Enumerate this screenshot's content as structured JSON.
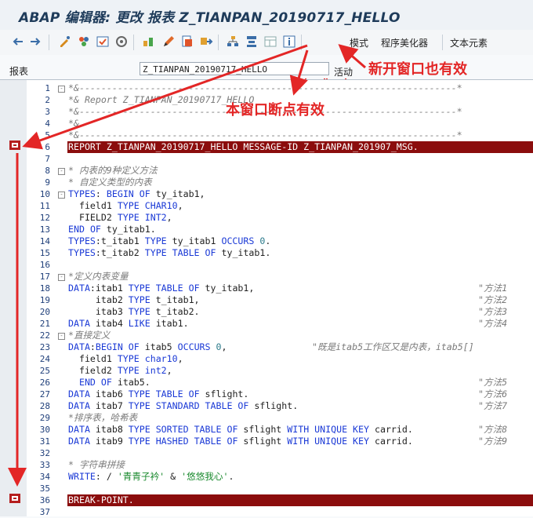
{
  "window": {
    "title": "ABAP 编辑器: 更改 报表 Z_TIANPAN_20190717_HELLO"
  },
  "toolbar": {
    "mode_label": "模式",
    "pretty_printer_label": "程序美化器",
    "text_elements_label": "文本元素"
  },
  "fields": {
    "report_label": "报表",
    "report_value": "Z_TIANPAN_20190717_HELLO",
    "status": "活动"
  },
  "annotations": {
    "new_window": "新开窗口也有效",
    "this_window": "本窗口断点有效"
  },
  "lines": [
    {
      "n": "1",
      "t": "*&---------------------------------------------------------------------*"
    },
    {
      "n": "2",
      "t": "*& Report Z_TIANPAN_20190717_HELLO"
    },
    {
      "n": "3",
      "t": "*&---------------------------------------------------------------------*"
    },
    {
      "n": "4",
      "t": "*&"
    },
    {
      "n": "5",
      "t": "*&---------------------------------------------------------------------*"
    },
    {
      "n": "6",
      "t": "REPORT Z_TIANPAN_20190717_HELLO MESSAGE-ID Z_TIANPAN_201907_MSG."
    },
    {
      "n": "7",
      "t": ""
    },
    {
      "n": "8",
      "t": "* 内表的9种定义方法"
    },
    {
      "n": "9",
      "t": "* 自定义类型的内表"
    },
    {
      "n": "10",
      "t": "TYPES: BEGIN OF ty_itab1,"
    },
    {
      "n": "11",
      "t": "  field1 TYPE CHAR10,"
    },
    {
      "n": "12",
      "t": "  FIELD2 TYPE INT2,"
    },
    {
      "n": "13",
      "t": "END OF ty_itab1."
    },
    {
      "n": "14",
      "t": "TYPES:t_itab1 TYPE ty_itab1 OCCURS 0."
    },
    {
      "n": "15",
      "t": "TYPES:t_itab2 TYPE TABLE OF ty_itab1."
    },
    {
      "n": "16",
      "t": ""
    },
    {
      "n": "17",
      "t": "*定义内表变量"
    },
    {
      "n": "18",
      "t": "DATA:itab1 TYPE TABLE OF ty_itab1,"
    },
    {
      "n": "19",
      "t": "     itab2 TYPE t_itab1,"
    },
    {
      "n": "20",
      "t": "     itab3 TYPE t_itab2."
    },
    {
      "n": "21",
      "t": "DATA itab4 LIKE itab1."
    },
    {
      "n": "22",
      "t": "*直接定义"
    },
    {
      "n": "23",
      "t": "DATA:BEGIN OF itab5 OCCURS 0,"
    },
    {
      "n": "24",
      "t": "  field1 TYPE char10,"
    },
    {
      "n": "25",
      "t": "  field2 TYPE int2,"
    },
    {
      "n": "26",
      "t": "  END OF itab5."
    },
    {
      "n": "27",
      "t": "DATA itab6 TYPE TABLE OF sflight."
    },
    {
      "n": "28",
      "t": "DATA itab7 TYPE STANDARD TABLE OF sflight."
    },
    {
      "n": "29",
      "t": "*排序表，哈希表"
    },
    {
      "n": "30",
      "t": "DATA itab8 TYPE SORTED TABLE OF sflight WITH UNIQUE KEY carrid."
    },
    {
      "n": "31",
      "t": "DATA itab9 TYPE HASHED TABLE OF sflight WITH UNIQUE KEY carrid."
    },
    {
      "n": "32",
      "t": ""
    },
    {
      "n": "33",
      "t": "* 字符串拼接"
    },
    {
      "n": "34",
      "t": "WRITE: / '青青子衿' & '悠悠我心'."
    },
    {
      "n": "35",
      "t": ""
    },
    {
      "n": "36",
      "t": "BREAK-POINT."
    },
    {
      "n": "37",
      "t": ""
    }
  ],
  "right_comments": [
    {
      "line": "18",
      "t": "\"方法1"
    },
    {
      "line": "19",
      "t": "\"方法2"
    },
    {
      "line": "20",
      "t": "\"方法3"
    },
    {
      "line": "21",
      "t": "\"方法4"
    },
    {
      "line": "23",
      "t": "\"既是itab5工作区又是内表，itab5[]"
    },
    {
      "line": "26",
      "t": "\"方法5"
    },
    {
      "line": "27",
      "t": "\"方法6"
    },
    {
      "line": "28",
      "t": "\"方法7"
    },
    {
      "line": "30",
      "t": "\"方法8"
    },
    {
      "line": "31",
      "t": "\"方法9"
    }
  ],
  "colors": {
    "highlight": "#8b0d0d",
    "keyword": "#1a39d6",
    "comment": "#7a7a7a",
    "annotation": "#e32626"
  }
}
